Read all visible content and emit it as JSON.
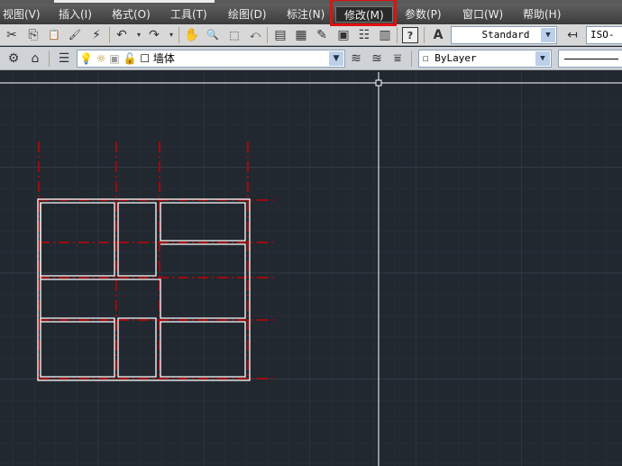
{
  "menu": [
    {
      "label": "视图(V)"
    },
    {
      "label": "插入(I)"
    },
    {
      "label": "格式(O)"
    },
    {
      "label": "工具(T)"
    },
    {
      "label": "绘图(D)"
    },
    {
      "label": "标注(N)"
    },
    {
      "label": "修改(M)",
      "active": true
    },
    {
      "label": "参数(P)"
    },
    {
      "label": "窗口(W)"
    },
    {
      "label": "帮助(H)"
    }
  ],
  "toolbar": {
    "text_style": "Standard",
    "dim_style": "ISO-"
  },
  "layers": {
    "current_layer": "墙体",
    "color": "ByLayer"
  },
  "icons": {
    "cut": "✂",
    "copy": "⎘",
    "paste": "📋",
    "matchprop": "🖌",
    "undo": "↶",
    "redo": "↷",
    "pan": "✋",
    "zoom": "🔍",
    "help": "?",
    "bulb": "💡",
    "sun": "☼",
    "lock": "🔓"
  },
  "colors": {
    "canvas": "#212830",
    "wall": "#ffffff",
    "axis": "#cc0000",
    "highlight": "#e01010"
  }
}
